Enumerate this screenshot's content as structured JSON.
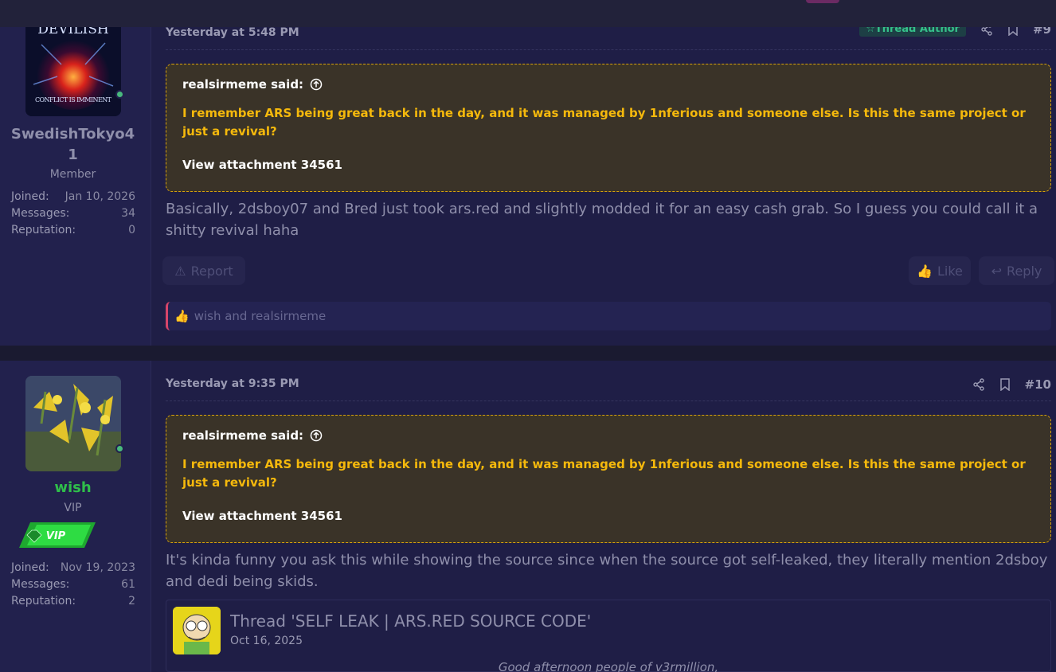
{
  "posts": [
    {
      "author": {
        "name": "SwedishTokyo41",
        "role": "Member",
        "avatar_text": "DEVILISH",
        "avatar_text_bottom": "CONFLICT IS IMMINENT",
        "joined_label": "Joined:",
        "joined": "Jan 10, 2026",
        "messages_label": "Messages:",
        "messages": "34",
        "reputation_label": "Reputation:",
        "reputation": "0"
      },
      "date": "Yesterday at 5:48 PM",
      "author_tag": "Thread Author",
      "post_number": "#9",
      "quote": {
        "author": "realsirmeme said:",
        "text": "I remember ARS being great back in the day, and it was managed by 1nferious and someone else. Is this the same project or just a revival?",
        "attachment": "View attachment 34561"
      },
      "body": "Basically, 2dsboy07 and Bred just took ars.red and slightly modded it for an easy cash grab. So I guess you could call it a shitty revival haha",
      "report_label": "Report",
      "like_label": "Like",
      "reply_label": "Reply",
      "reactions": "wish and realsirmeme"
    },
    {
      "author": {
        "name": "wish",
        "role": "VIP",
        "badge": "VIP",
        "joined_label": "Joined:",
        "joined": "Nov 19, 2023",
        "messages_label": "Messages:",
        "messages": "61",
        "reputation_label": "Reputation:",
        "reputation": "2"
      },
      "date": "Yesterday at 9:35 PM",
      "post_number": "#10",
      "quote": {
        "author": "realsirmeme said:",
        "text": "I remember ARS being great back in the day, and it was managed by 1nferious and someone else. Is this the same project or just a revival?",
        "attachment": "View attachment 34561"
      },
      "body": "It's kinda funny you ask this while showing the source since when the source got self-leaked, they literally mention 2dsboy and dedi being skids.",
      "thread_embed": {
        "title": "Thread 'SELF LEAK | ARS.RED SOURCE CODE'",
        "date": "Oct 16, 2025",
        "snippet": "Good afternoon people of v3rmillion,"
      }
    }
  ],
  "colors": {
    "page_bg": "#1e1d45",
    "quote_border": "#d9a30d",
    "quote_text": "#f5b90c",
    "vip_green": "#2ecc40",
    "online_dot": "#48b97d",
    "author_tag": "#35c08a",
    "reaction_bar": "#d7456a"
  },
  "icons": [
    "share-icon",
    "bookmark-icon",
    "arrow-up-circle-icon",
    "warning-icon",
    "thumbs-up-icon",
    "reply-icon",
    "star-icon",
    "gem-icon"
  ]
}
